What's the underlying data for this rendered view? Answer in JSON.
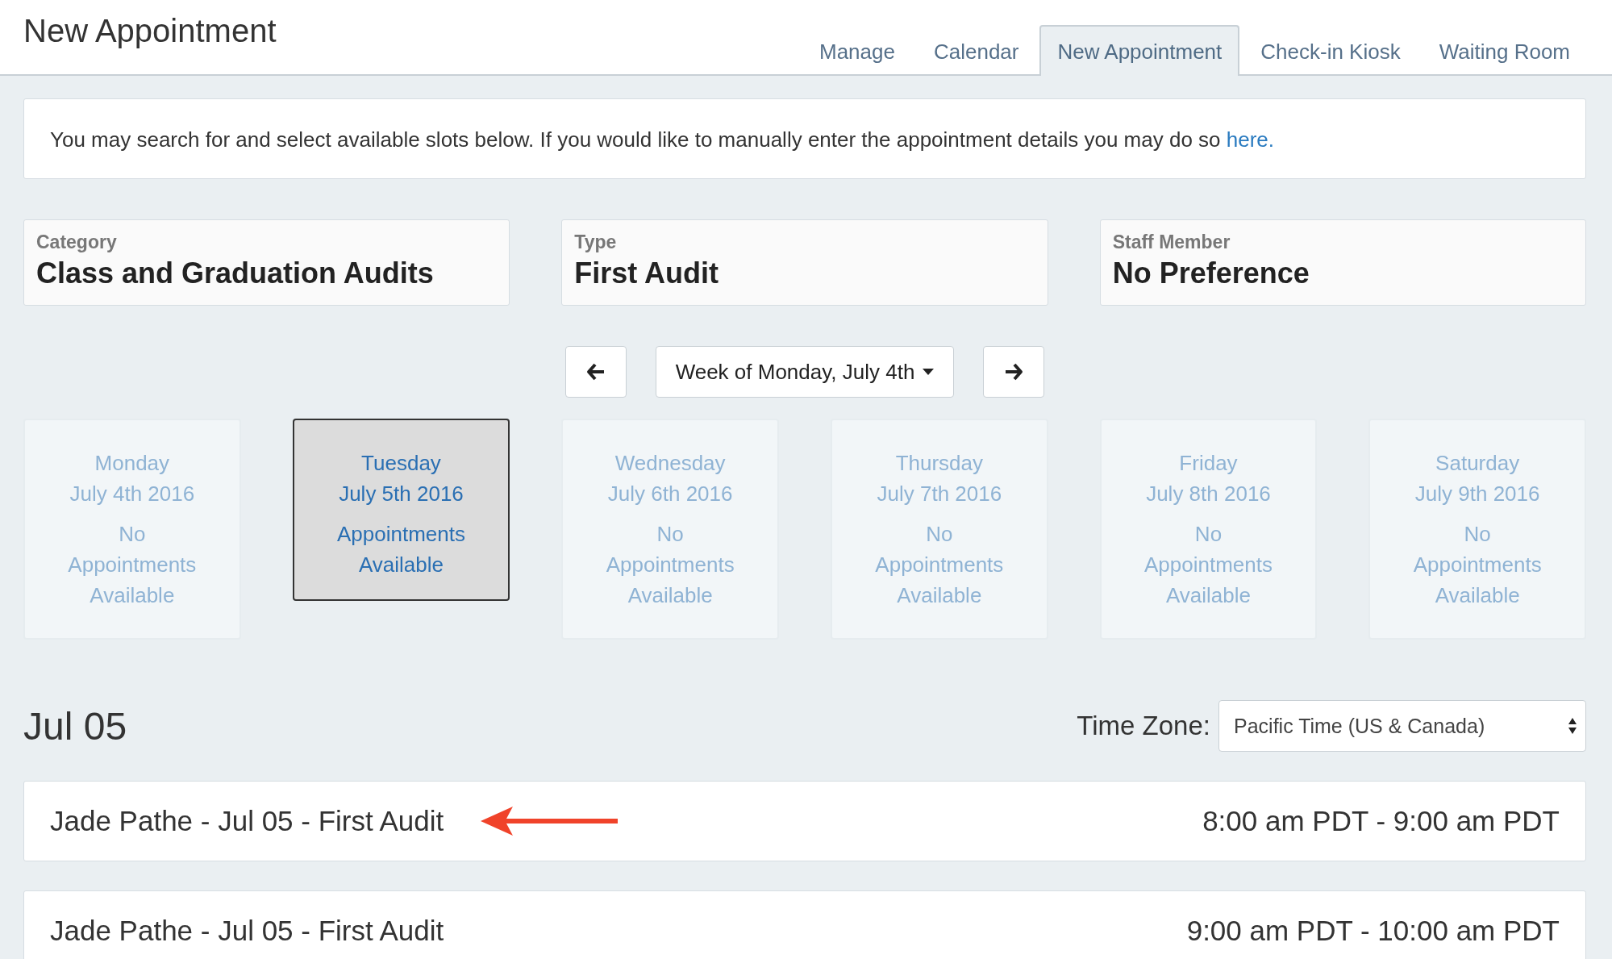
{
  "header": {
    "title": "New Appointment"
  },
  "tabs": [
    {
      "label": "Manage",
      "selected": false
    },
    {
      "label": "Calendar",
      "selected": false
    },
    {
      "label": "New Appointment",
      "selected": true
    },
    {
      "label": "Check-in Kiosk",
      "selected": false
    },
    {
      "label": "Waiting Room",
      "selected": false
    }
  ],
  "intro": {
    "text": "You may search for and select available slots below. If you would like to manually enter the appointment details you may do so",
    "link": "here."
  },
  "filters": [
    {
      "label": "Category",
      "value": "Class and Graduation Audits"
    },
    {
      "label": "Type",
      "value": "First Audit"
    },
    {
      "label": "Staff Member",
      "value": "No Preference"
    }
  ],
  "week": {
    "label": "Week of Monday, July 4th"
  },
  "days": [
    {
      "day": "Monday",
      "date": "July 4th 2016",
      "availability": "No Appointments Available",
      "selected": false
    },
    {
      "day": "Tuesday",
      "date": "July 5th 2016",
      "availability": "Appointments Available",
      "selected": true
    },
    {
      "day": "Wednesday",
      "date": "July 6th 2016",
      "availability": "No Appointments Available",
      "selected": false
    },
    {
      "day": "Thursday",
      "date": "July 7th 2016",
      "availability": "No Appointments Available",
      "selected": false
    },
    {
      "day": "Friday",
      "date": "July 8th 2016",
      "availability": "No Appointments Available",
      "selected": false
    },
    {
      "day": "Saturday",
      "date": "July 9th 2016",
      "availability": "No Appointments Available",
      "selected": false
    }
  ],
  "section": {
    "title": "Jul 05",
    "timezone_label": "Time Zone:",
    "timezone_value": "Pacific Time (US & Canada)"
  },
  "appointments": [
    {
      "title": "Jade Pathe - Jul 05 - First Audit",
      "time": "8:00 am PDT - 9:00 am PDT",
      "annotated": true
    },
    {
      "title": "Jade Pathe - Jul 05 - First Audit",
      "time": "9:00 am PDT - 10:00 am PDT",
      "annotated": false
    }
  ]
}
